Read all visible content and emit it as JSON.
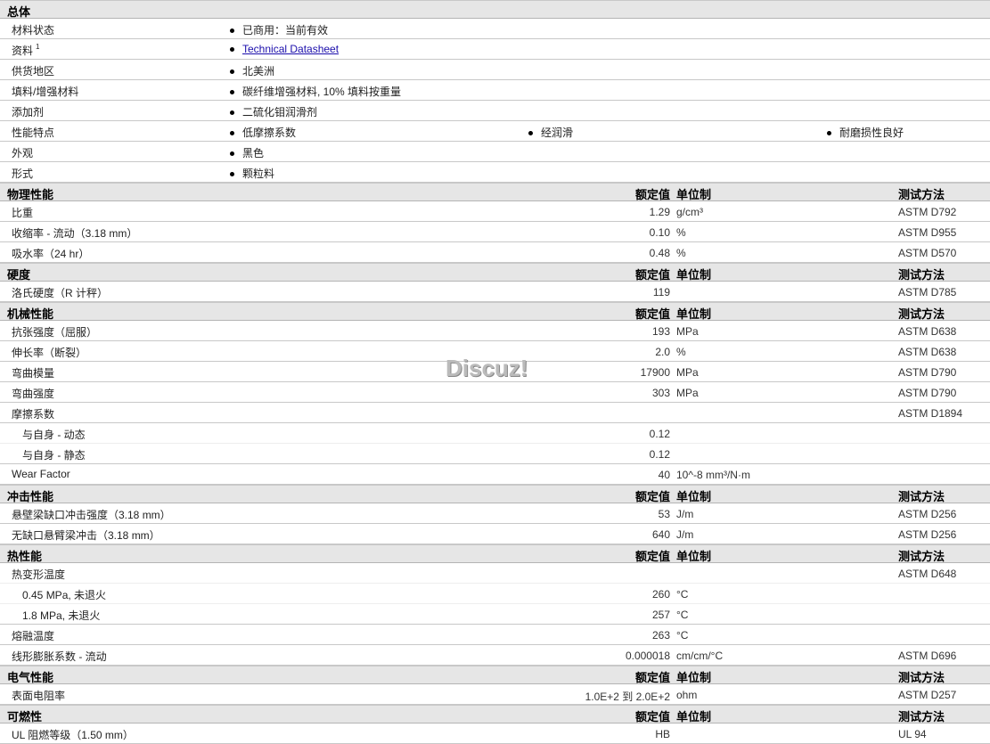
{
  "general": {
    "title": "总体",
    "rows": [
      {
        "label": "材料状态",
        "values": [
          "已商用：当前有效"
        ]
      },
      {
        "label": "资料",
        "sup": "1",
        "values": [
          "Technical Datasheet"
        ],
        "link": true
      },
      {
        "label": "供货地区",
        "values": [
          "北美洲"
        ]
      },
      {
        "label": "填料/增强材料",
        "values": [
          "碳纤维增强材料, 10% 填料按重量"
        ]
      },
      {
        "label": "添加剂",
        "values": [
          "二硫化钼润滑剂"
        ]
      },
      {
        "label": "性能特点",
        "values": [
          "低摩擦系数",
          "经润滑",
          "耐磨损性良好"
        ]
      },
      {
        "label": "外观",
        "values": [
          "黑色"
        ]
      },
      {
        "label": "形式",
        "values": [
          "颗粒料"
        ]
      }
    ]
  },
  "col_headers": {
    "value": "额定值",
    "unit": "单位制",
    "method": "测试方法"
  },
  "sections": [
    {
      "title": "物理性能",
      "rows": [
        {
          "label": "比重",
          "value": "1.29",
          "unit": "g/cm³",
          "method": "ASTM D792"
        },
        {
          "label": "收缩率 - 流动（3.18 mm）",
          "value": "0.10",
          "unit": "%",
          "method": "ASTM D955"
        },
        {
          "label": "吸水率（24 hr）",
          "value": "0.48",
          "unit": "%",
          "method": "ASTM D570"
        }
      ]
    },
    {
      "title": "硬度",
      "rows": [
        {
          "label": "洛氏硬度（R 计秤）",
          "value": "119",
          "unit": "",
          "method": "ASTM D785"
        }
      ]
    },
    {
      "title": "机械性能",
      "rows": [
        {
          "label": "抗张强度（屈服）",
          "value": "193",
          "unit": "MPa",
          "method": "ASTM D638"
        },
        {
          "label": "伸长率（断裂）",
          "value": "2.0",
          "unit": "%",
          "method": "ASTM D638"
        },
        {
          "label": "弯曲模量",
          "value": "17900",
          "unit": "MPa",
          "method": "ASTM D790"
        },
        {
          "label": "弯曲强度",
          "value": "303",
          "unit": "MPa",
          "method": "ASTM D790"
        },
        {
          "label": "摩擦系数",
          "value": "",
          "unit": "",
          "method": "ASTM D1894",
          "sub_next": true
        },
        {
          "label": "与自身 - 动态",
          "value": "0.12",
          "unit": "",
          "method": "",
          "indent": true,
          "sub": true
        },
        {
          "label": "与自身 - 静态",
          "value": "0.12",
          "unit": "",
          "method": "",
          "indent": true
        },
        {
          "label": "Wear Factor",
          "value": "40",
          "unit": "10^-8 mm³/N·m",
          "method": ""
        }
      ]
    },
    {
      "title": "冲击性能",
      "rows": [
        {
          "label": "悬壁梁缺口冲击强度（3.18 mm）",
          "value": "53",
          "unit": "J/m",
          "method": "ASTM D256"
        },
        {
          "label": "无缺口悬臂梁冲击（3.18 mm）",
          "value": "640",
          "unit": "J/m",
          "method": "ASTM D256"
        }
      ]
    },
    {
      "title": "热性能",
      "rows": [
        {
          "label": "热变形温度",
          "value": "",
          "unit": "",
          "method": "ASTM D648",
          "sub": true
        },
        {
          "label": "0.45 MPa, 未退火",
          "value": "260",
          "unit": "°C",
          "method": "",
          "indent": true,
          "sub": true
        },
        {
          "label": "1.8 MPa, 未退火",
          "value": "257",
          "unit": "°C",
          "method": "",
          "indent": true
        },
        {
          "label": "熔融温度",
          "value": "263",
          "unit": "°C",
          "method": ""
        },
        {
          "label": "线形膨胀系数 - 流动",
          "value": "0.000018",
          "unit": "cm/cm/°C",
          "method": "ASTM D696"
        }
      ]
    },
    {
      "title": "电气性能",
      "rows": [
        {
          "label": "表面电阻率",
          "value": "1.0E+2 到 2.0E+2",
          "unit": "ohm",
          "method": "ASTM D257"
        }
      ]
    },
    {
      "title": "可燃性",
      "rows": [
        {
          "label": "UL 阻燃等级（1.50 mm）",
          "value": "HB",
          "unit": "",
          "method": "UL 94"
        }
      ]
    }
  ],
  "watermark": "Discuz!"
}
